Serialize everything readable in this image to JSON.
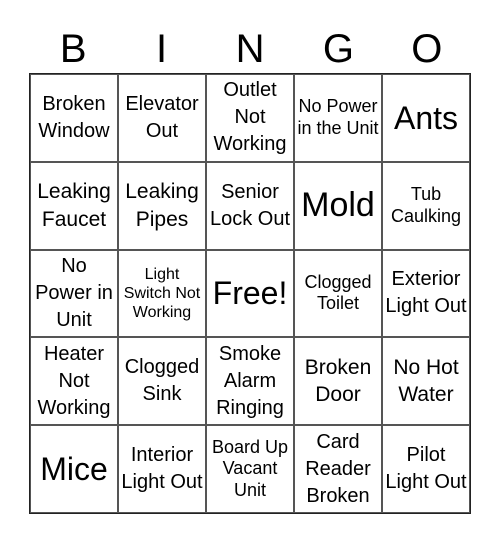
{
  "header": {
    "letters": [
      "B",
      "I",
      "N",
      "G",
      "O"
    ]
  },
  "cells": [
    [
      "Broken Window",
      "Elevator Out",
      "Outlet Not Working",
      "No Power in the Unit",
      "Ants"
    ],
    [
      "Leaking Faucet",
      "Leaking Pipes",
      "Senior Lock Out",
      "Mold",
      "Tub Caulking"
    ],
    [
      "No Power in Unit",
      "Light Switch Not Working",
      "Free!",
      "Clogged Toilet",
      "Exterior Light Out"
    ],
    [
      "Heater Not Working",
      "Clogged Sink",
      "Smoke Alarm Ringing",
      "Broken Door",
      "No Hot Water"
    ],
    [
      "Mice",
      "Interior Light Out",
      "Board Up Vacant Unit",
      "Card Reader Broken",
      "Pilot Light Out"
    ]
  ]
}
